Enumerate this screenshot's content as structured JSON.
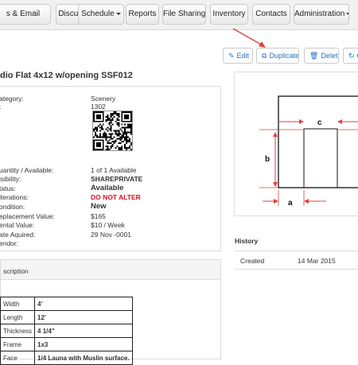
{
  "nav": {
    "tabs": [
      {
        "label": "s & Email",
        "name": "nav-tab-messages-email"
      },
      {
        "label": "Discussion",
        "name": "nav-tab-discussion"
      },
      {
        "label": "Schedule",
        "name": "nav-tab-schedule",
        "dropdown": true
      },
      {
        "label": "Reports",
        "name": "nav-tab-reports"
      },
      {
        "label": "File Sharing",
        "name": "nav-tab-file-sharing"
      },
      {
        "label": "Inventory",
        "name": "nav-tab-inventory"
      },
      {
        "label": "Contacts",
        "name": "nav-tab-contacts"
      },
      {
        "label": "Administration",
        "name": "nav-tab-administration",
        "dropdown": true
      }
    ]
  },
  "actions": {
    "edit_label": "Edit",
    "duplicate_label": "Duplicate",
    "delete_label": "Delete",
    "extra_label": "C",
    "annotation_arrow_color": "#e2403a"
  },
  "item": {
    "title": "dio Flat 4x12 w/opening SSF012",
    "details": [
      {
        "label": "ategory:",
        "value": "Scenery"
      },
      {
        "label": ":",
        "value": "1302"
      },
      {
        "label": "uantity / Available:",
        "value": "1 of 1 Available"
      },
      {
        "label": "isibility:",
        "value": "SHAREPRIVATE"
      },
      {
        "label": "tatus:",
        "value": "Available"
      },
      {
        "label": "lterations:",
        "value": "DO NOT ALTER"
      },
      {
        "label": "ondition:",
        "value": "New"
      },
      {
        "label": "eplacement Value:",
        "value": "$165"
      },
      {
        "label": "ental Value:",
        "value": "$10 / Week"
      },
      {
        "label": "ate Aquired:",
        "value": "29 Nov -0001"
      },
      {
        "label": "endor:",
        "value": ""
      }
    ]
  },
  "diagram": {
    "label_a": "a",
    "label_b": "b",
    "label_c": "c",
    "arrow_color": "#e2403a"
  },
  "history": {
    "heading": "History",
    "rows": [
      {
        "event": "Created",
        "date": "14 Mar 2015"
      }
    ]
  },
  "description": {
    "heading": "scription",
    "specs": [
      {
        "key": "Width",
        "value": "4'"
      },
      {
        "key": "Length",
        "value": "12'"
      },
      {
        "key": "Thickness",
        "value": "4 1/4\""
      },
      {
        "key": "Frame",
        "value": "1x3"
      },
      {
        "key": "Face",
        "value": "1/4 Launa with Muslin surface."
      }
    ]
  }
}
